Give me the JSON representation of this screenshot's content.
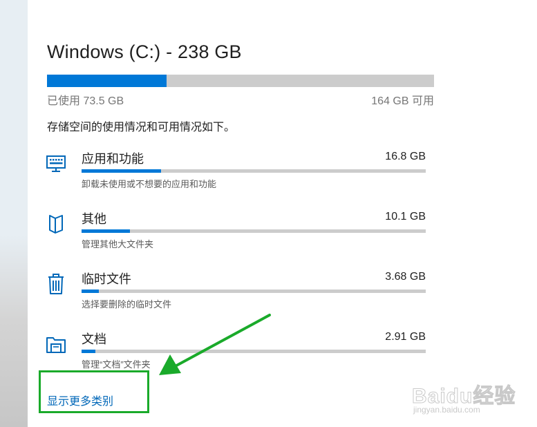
{
  "drive": {
    "title": "Windows (C:) - 238 GB",
    "used_label": "已使用 73.5 GB",
    "free_label": "164 GB 可用",
    "used_fraction": 0.309
  },
  "description": "存储空间的使用情况和可用情况如下。",
  "categories": [
    {
      "name": "应用和功能",
      "size": "16.8 GB",
      "subtitle": "卸载未使用或不想要的应用和功能",
      "fraction": 0.23,
      "icon": "keyboard-monitor-icon"
    },
    {
      "name": "其他",
      "size": "10.1 GB",
      "subtitle": "管理其他大文件夹",
      "fraction": 0.14,
      "icon": "folder-page-icon"
    },
    {
      "name": "临时文件",
      "size": "3.68 GB",
      "subtitle": "选择要删除的临时文件",
      "fraction": 0.05,
      "icon": "trash-icon"
    },
    {
      "name": "文档",
      "size": "2.91 GB",
      "subtitle": "管理“文档”文件夹",
      "fraction": 0.04,
      "icon": "documents-folder-icon"
    }
  ],
  "show_more": "显示更多类别",
  "watermark": {
    "main": "Baidu经验",
    "sub": "jingyan.baidu.com"
  },
  "colors": {
    "accent": "#0078d7",
    "bar_track": "#cccccc",
    "link": "#0067b8",
    "annotation_green": "#1aaa2a"
  }
}
